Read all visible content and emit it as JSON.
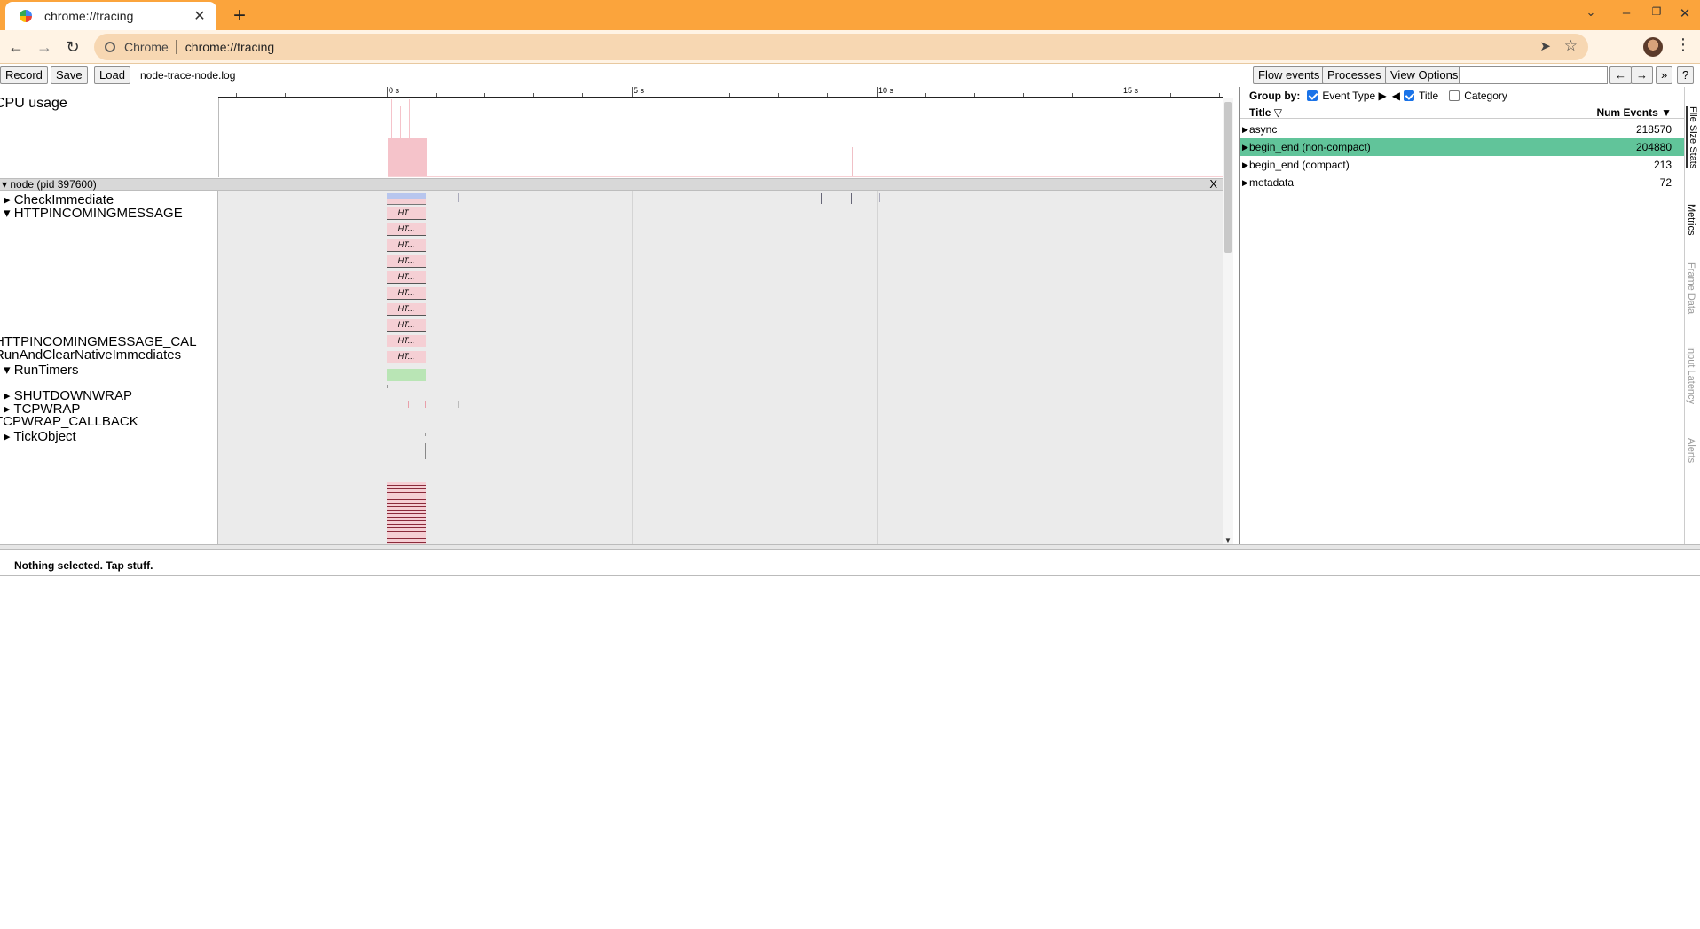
{
  "browser": {
    "tab_title": "chrome://tracing",
    "new_tab_glyph": "+",
    "tab_close_glyph": "✕",
    "omnibox_chip": "Chrome",
    "url": "chrome://tracing",
    "icons": [
      "back-arrow-icon",
      "forward-arrow-icon",
      "reload-icon",
      "site-info-icon",
      "send-icon",
      "star-icon",
      "avatar",
      "kebab-menu-icon",
      "tab-search-icon",
      "minimize-icon",
      "restore-icon",
      "close-icon"
    ]
  },
  "trace_toolbar": {
    "record": "Record",
    "save": "Save",
    "load": "Load",
    "file_name": "node-trace-node.log",
    "flow_events": "Flow events",
    "processes": "Processes",
    "view_options": "View Options",
    "search_value": "",
    "prev": "←",
    "next": "→",
    "more": "»",
    "help": "?"
  },
  "timeline": {
    "ruler_labels": [
      "0 s",
      "5 s",
      "10 s",
      "15 s"
    ],
    "cpu_label": "CPU usage",
    "process_header": "▾ node (pid 397600)",
    "process_close": "X",
    "tracks": [
      {
        "label": "▸  CheckImmediate"
      },
      {
        "label": "▾  HTTPINCOMINGMESSAGE"
      },
      {
        "label": "HTTPINCOMINGMESSAGE_CAL"
      },
      {
        "label": "RunAndClearNativeImmediates"
      },
      {
        "label": "▾  RunTimers"
      },
      {
        "label": "▸  SHUTDOWNWRAP"
      },
      {
        "label": "▸  TCPWRAP"
      },
      {
        "label": "TCPWRAP_CALLBACK"
      },
      {
        "label": "▸  TickObject"
      }
    ],
    "slice_label": "HT..."
  },
  "analysis": {
    "group_by": "Group by:",
    "event_type": "Event Type ▶",
    "title_opt": "Title",
    "category_opt": "Category",
    "left_arrow": "◀",
    "col_title": "Title ▽",
    "col_num": "Num Events ▼",
    "rows": [
      {
        "title": "async",
        "count": "218570"
      },
      {
        "title": "begin_end (non-compact)",
        "count": "204880"
      },
      {
        "title": "begin_end (compact)",
        "count": "213"
      },
      {
        "title": "metadata",
        "count": "72"
      }
    ]
  },
  "side_tabs": [
    "File Size Stats",
    "Metrics",
    "Frame Data",
    "Input Latency",
    "Alerts"
  ],
  "status": "Nothing selected. Tap stuff."
}
